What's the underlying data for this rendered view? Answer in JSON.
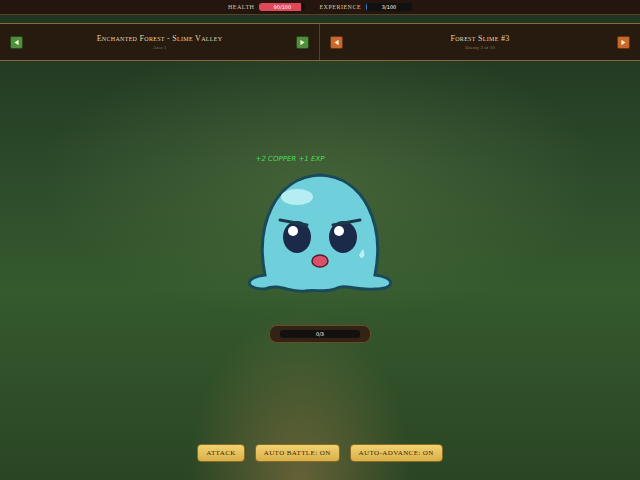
{
  "stats": [
    {
      "label": "HEALTH",
      "value": "90/100",
      "level": 0.9,
      "color": "#e0485a"
    },
    {
      "label": "EXPERIENCE",
      "value": "3/100",
      "level": 0.03,
      "color": "#3a7bd5"
    }
  ],
  "navigation": [
    {
      "title": "Enchanted Forest - Slime Valley",
      "subtitle": "Area 1",
      "color": "#4e8f3a"
    },
    {
      "title": "Forest Slime #3",
      "subtitle": "Enemy 3 of 10",
      "color": "#c8682a"
    }
  ],
  "reward": "+2 COPPER +1 EXP",
  "enemy": {
    "hp": "0/3",
    "level": 0
  },
  "buttons": [
    "ATTACK",
    "AUTO BATTLE: ON",
    "AUTO-ADVANCE: ON"
  ]
}
